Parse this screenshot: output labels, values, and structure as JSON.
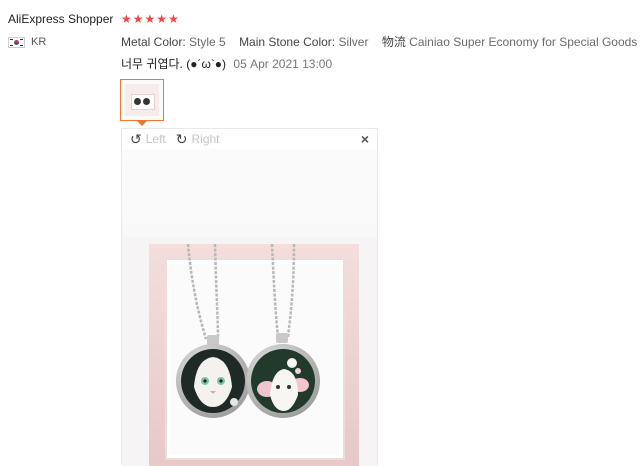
{
  "user": {
    "name": "AliExpress Shopper",
    "country": "KR",
    "flag_icon": "south-korea-flag-icon"
  },
  "rating": {
    "stars": 5,
    "star_icon": "star-icon",
    "color": "#f04646"
  },
  "attributes": [
    {
      "key": "Metal Color:",
      "value": "Style 5"
    },
    {
      "key": "Main Stone Color:",
      "value": "Silver"
    },
    {
      "key": "物流",
      "value": "Cainiao Super Economy for Special Goods"
    }
  ],
  "review": {
    "text": "너무 귀엽다. (●´ω`●)",
    "date": "05 Apr 2021 13:00"
  },
  "viewer": {
    "rotate_left_label": "Left",
    "rotate_right_label": "Right",
    "rotate_left_icon": "rotate-left-icon",
    "rotate_right_icon": "rotate-right-icon",
    "close_icon": "close-icon",
    "accent": "#f0762c"
  }
}
